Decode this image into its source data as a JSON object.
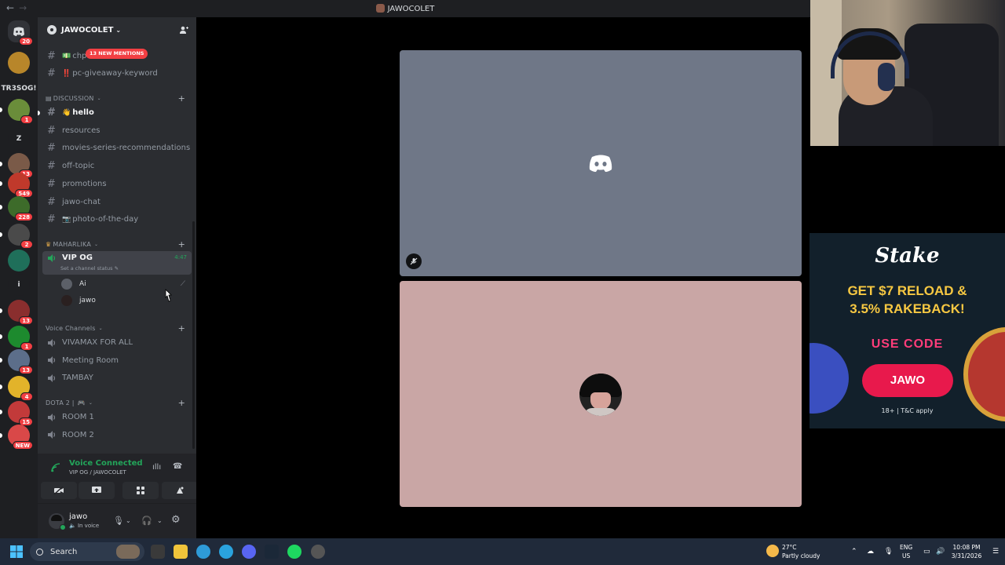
{
  "window": {
    "title": "JAWOCOLET",
    "back": "←",
    "forward": "→"
  },
  "server": {
    "name": "JAWOCOLET",
    "chevron": "⌄"
  },
  "rail": {
    "home_badge": "20",
    "servers": [
      {
        "name": "prestige",
        "color": "#b8862a",
        "badge": ""
      },
      {
        "name": "tr3sog",
        "color": "#1e1f22",
        "badge": "",
        "text": "TR3SOG!"
      },
      {
        "name": "pokemon",
        "color": "#6a8d3a",
        "badge": "1"
      },
      {
        "name": "z",
        "color": "#1e1f22",
        "badge": "",
        "text": "Z"
      },
      {
        "name": "group-a",
        "color": "#7a5a48",
        "badge": "13"
      },
      {
        "name": "group-b",
        "color": "#c0392b",
        "badge": "549"
      },
      {
        "name": "group-c",
        "color": "#3d6b2a",
        "badge": "228"
      },
      {
        "name": "group-d",
        "color": "#4a4a4a",
        "badge": "2"
      },
      {
        "name": "group-e",
        "color": "#1f6f5a",
        "badge": ""
      },
      {
        "name": "i",
        "color": "#1e1f22",
        "badge": "",
        "text": "i"
      },
      {
        "name": "group-f",
        "color": "#8a2e2e",
        "badge": "13"
      },
      {
        "name": "group-g",
        "color": "#1d8a2e",
        "badge": "1"
      },
      {
        "name": "group-h",
        "color": "#5c6e8a",
        "badge": "13"
      },
      {
        "name": "group-i",
        "color": "#e2b32a",
        "badge": "4"
      },
      {
        "name": "group-j",
        "color": "#c23a3a",
        "badge": "15"
      },
      {
        "name": "group-k",
        "color": "#d94848",
        "badge": "NEW"
      }
    ]
  },
  "mentions_label": "13 NEW MENTIONS",
  "channels_top": [
    {
      "label": "chp",
      "emoji": "💵"
    },
    {
      "label": "pc-giveaway-keyword",
      "emoji": "‼️"
    }
  ],
  "categories": {
    "discussion": "DISCUSSION",
    "maharlika": "MAHARLIKA",
    "voice": "Voice Channels",
    "dota": "DOTA 2 |"
  },
  "discussion_channels": [
    {
      "label": "hello",
      "emoji": "👋"
    },
    {
      "label": "resources"
    },
    {
      "label": "movies-series-recommendations"
    },
    {
      "label": "off-topic"
    },
    {
      "label": "promotions"
    },
    {
      "label": "jawo-chat"
    },
    {
      "label": "photo-of-the-day",
      "emoji": "📷"
    }
  ],
  "active_voice": {
    "name": "VIP OG",
    "time": "4:47",
    "status": "Set a channel status ✎"
  },
  "voice_users": [
    {
      "name": "Ai"
    },
    {
      "name": "jawo"
    }
  ],
  "voice_channels": [
    "VIVAMAX FOR ALL",
    "Meeting Room",
    "TAMBAY"
  ],
  "dota_channels": [
    "ROOM 1",
    "ROOM 2"
  ],
  "voice_panel": {
    "status": "Voice Connected",
    "location": "VIP OG / JAWOCOLET"
  },
  "user": {
    "name": "jawo",
    "status": "In voice"
  },
  "ad": {
    "brand": "Stake",
    "headline_1": "GET $7 RELOAD &",
    "headline_2": "3.5% RAKEBACK!",
    "code_label": "USE CODE",
    "code": "JAWO",
    "disclaimer": "18+ | T&C apply"
  },
  "taskbar": {
    "search": "Search",
    "temperature": "27°C",
    "condition": "Partly cloudy",
    "lang_1": "ENG",
    "lang_2": "US",
    "time": "10:08 PM",
    "date": "3/31/2026"
  }
}
